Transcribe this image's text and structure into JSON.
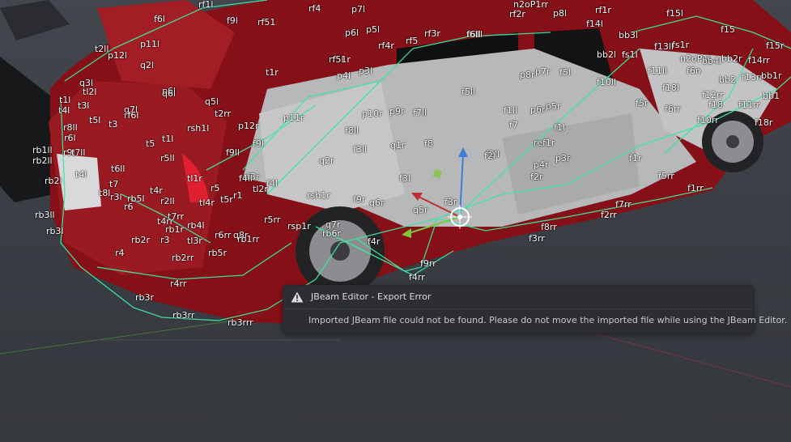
{
  "colors": {
    "background": "#3d4046",
    "car_body": "#8a1117",
    "interior": "#b9b9bb",
    "beam_lines": "#3ee6a0",
    "axis_x": "#c03030",
    "axis_y": "#7ec63a",
    "axis_z": "#3d7fd6"
  },
  "toast": {
    "icon": "warning-icon",
    "title": "JBeam Editor - Export Error",
    "message": "Imported JBeam file could not be found. Please do not move the imported file while using the JBeam Editor."
  },
  "node_labels": [
    "rf1l",
    "f6l",
    "t2ll",
    "p12l",
    "p11l",
    "q2l",
    "q3l",
    "tl2l",
    "t3l",
    "t1l",
    "t4l",
    "r8ll",
    "t5l",
    "t3",
    "p6l",
    "q7l",
    "rf6l",
    "q6l",
    "q5l",
    "t2rr",
    "rsh1l",
    "t1l",
    "r6l",
    "r9l",
    "rb1ll",
    "rb2ll",
    "t7ll",
    "rb2l",
    "t4l",
    "t6ll",
    "t7",
    "t8l",
    "r3l",
    "rb5l",
    "t4r",
    "r2ll",
    "r6",
    "t5",
    "r5ll",
    "rb3ll",
    "rb4l",
    "rb3l",
    "r4",
    "rb2r",
    "r3",
    "rb1r",
    "t7rr",
    "t4rr",
    "tl3r",
    "tl1r",
    "r5",
    "t5r",
    "tl4r",
    "tl2r",
    "r1",
    "f4l",
    "f3r",
    "f4ll",
    "p12r",
    "f9ll",
    "f9l",
    "p11r",
    "p10r",
    "f8ll",
    "f3ll",
    "q2r",
    "rsh1r",
    "f9r",
    "q6r",
    "q5r",
    "f3r",
    "rb5r",
    "r6rr",
    "q8r",
    "rb1rr",
    "rb2rr",
    "r4rr",
    "rb3r",
    "rb3rr",
    "rb3rrr",
    "r5rr",
    "rsp1r",
    "q7r",
    "rb6r",
    "f4r",
    "f9rr",
    "f4rr",
    "rf5l",
    "rf4",
    "rf51",
    "f6ll",
    "f9l",
    "t1r",
    "p4l",
    "p3l",
    "f7ll",
    "q1r",
    "f8",
    "f2ll",
    "f3l",
    "f5ll",
    "p9r",
    "f1ll",
    "f7",
    "p6r",
    "p5r",
    "f1l",
    "ref1r",
    "p3r",
    "p4r",
    "f2r",
    "f2l",
    "p8r",
    "p7r",
    "f5l",
    "f10ll",
    "f5r",
    "f6rr",
    "f1r",
    "f5rr",
    "f7rr",
    "f8rr",
    "f3rr",
    "f2rr",
    "f1rr",
    "f10rr",
    "f18l",
    "f12rr",
    "f18",
    "f11rr",
    "f18r",
    "f15l",
    "f15",
    "f15r",
    "f14rr",
    "f13rr",
    "bb2r",
    "bb1r",
    "bb1",
    "bb2",
    "n2oP1l",
    "n2oP1rr",
    "bb4l",
    "bb3l",
    "bb2l",
    "fs1l",
    "fs1r",
    "f14l",
    "p8l",
    "p7l",
    "p6l",
    "p5l",
    "rf4r",
    "rf3r",
    "rf5",
    "rf1r",
    "rf2r",
    "rf51r",
    "f6lll",
    "f11ll",
    "f13ll",
    "f6n"
  ]
}
